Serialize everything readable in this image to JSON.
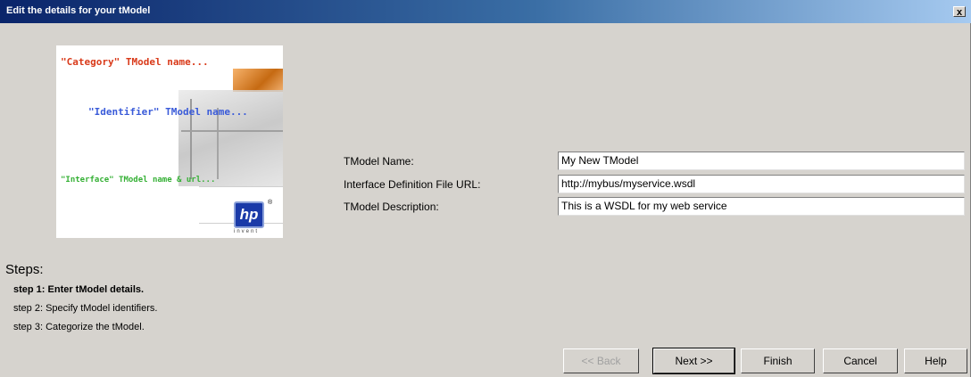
{
  "window": {
    "title": "Edit the details for your tModel",
    "close_glyph": "x"
  },
  "banner": {
    "category_text": "\"Category\" TModel name...",
    "identifier_text": "\"Identifier\" TModel name...",
    "interface_text": "\"Interface\" TModel name & url...",
    "logo_text": "hp",
    "logo_sub": "invent",
    "logo_reg": "®"
  },
  "form": {
    "name_label": "TModel Name:",
    "name_value": "My New TModel",
    "url_label": "Interface Definition File URL:",
    "url_value": "http://mybus/myservice.wsdl",
    "desc_label": "TModel Description:",
    "desc_value": "This is a WSDL for my web service"
  },
  "steps": {
    "title": "Steps:",
    "items": [
      {
        "label": "step 1: Enter tModel details.",
        "current": true
      },
      {
        "label": "step 2: Specify tModel identifiers.",
        "current": false
      },
      {
        "label": "step 3: Categorize the tModel.",
        "current": false
      }
    ]
  },
  "buttons": {
    "back": "<< Back",
    "next": "Next >>",
    "finish": "Finish",
    "cancel": "Cancel",
    "help": "Help"
  }
}
